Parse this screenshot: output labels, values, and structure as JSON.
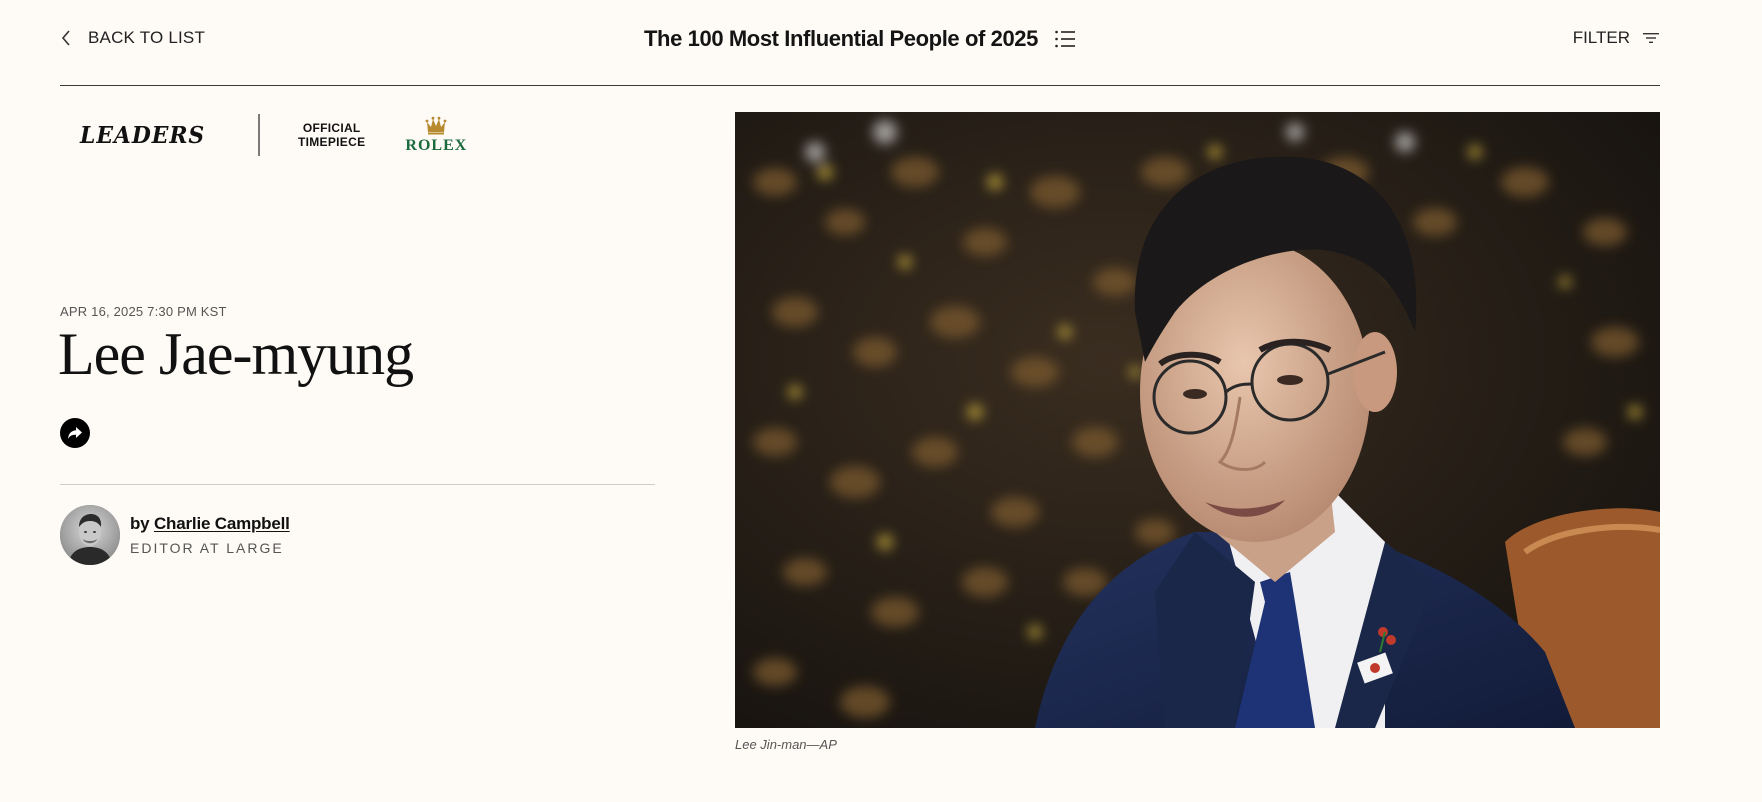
{
  "topnav": {
    "back_label": "BACK TO LIST",
    "title": "The 100 Most Influential People of 2025",
    "filter_label": "FILTER"
  },
  "sponsor": {
    "category": "LEADERS",
    "timepiece_line1": "OFFICIAL",
    "timepiece_line2": "TIMEPIECE",
    "brand": "ROLEX",
    "brand_color": "#1c6b3e"
  },
  "article": {
    "date": "APR 16, 2025 7:30 PM KST",
    "headline": "Lee Jae-myung",
    "share_icon": "share-arrow-icon",
    "author": {
      "by": "by",
      "name": "Charlie Campbell",
      "role": "EDITOR AT LARGE"
    },
    "image_caption": "Lee Jin-man—AP"
  },
  "colors": {
    "background": "#fefbf6",
    "text": "#141414",
    "muted": "#555555"
  }
}
